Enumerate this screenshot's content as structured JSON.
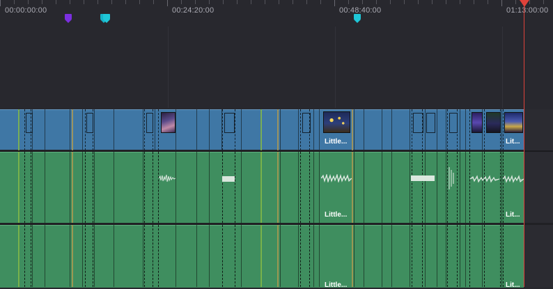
{
  "timeline": {
    "ruler": {
      "timecodes": [
        "00:00:00:00",
        "00:24:20:00",
        "00:48:40:00",
        "01:13:00:00"
      ]
    },
    "markers": [
      {
        "name": "marker-purple",
        "color": "#7b2fe0"
      },
      {
        "name": "marker-teal-1",
        "color": "#17b3c9"
      },
      {
        "name": "marker-teal-2",
        "color": "#1fc7d8"
      },
      {
        "name": "marker-teal-3",
        "color": "#1fc7d8"
      }
    ],
    "video_track": {
      "clip_labels": [
        "Little...",
        "Lit..."
      ]
    },
    "audio_track_1": {
      "clip_labels": [
        "Little...",
        "Lit..."
      ]
    },
    "audio_track_2": {
      "clip_labels": [
        "Little...",
        "Lit..."
      ]
    },
    "colors": {
      "video_clip": "#3f77a5",
      "audio_clip": "#3f8e5f",
      "playhead": "#e0423a",
      "background": "#28282e"
    }
  }
}
